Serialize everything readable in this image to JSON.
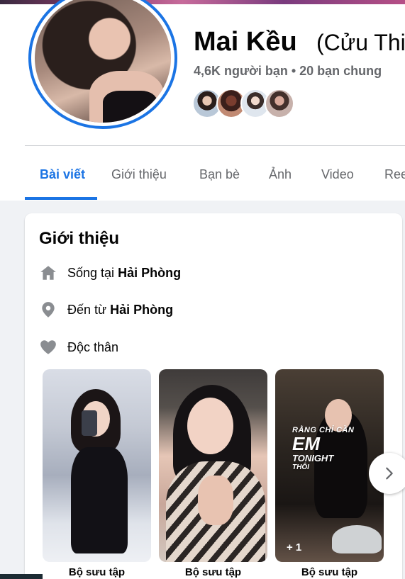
{
  "profile": {
    "name": "Mai Kều",
    "alias": "(Cửu Thi",
    "stats": "4,6K người bạn • 20 bạn chung",
    "mutual_friend_avatars": [
      "friend-avatar",
      "friend-avatar",
      "friend-avatar",
      "friend-avatar"
    ]
  },
  "tabs": [
    {
      "label": "Bài viết",
      "active": true
    },
    {
      "label": "Giới thiệu"
    },
    {
      "label": "Bạn bè"
    },
    {
      "label": "Ảnh"
    },
    {
      "label": "Video"
    },
    {
      "label": "Ree"
    }
  ],
  "intro": {
    "title": "Giới thiệu",
    "lives_in_prefix": "Sống tại",
    "lives_in_place": "Hải Phòng",
    "from_prefix": "Đến từ",
    "from_place": "Hải Phòng",
    "relationship": "Độc thân"
  },
  "featured": {
    "items": [
      {
        "caption": "Bộ sưu tập"
      },
      {
        "caption": "Bộ sưu tập"
      },
      {
        "caption": "Bộ sưu tập",
        "more": "+ 1",
        "overlay": {
          "line1": "RẰNG CHỈ CẦN",
          "line2": "EM",
          "line3": "TONIGHT",
          "line4": "THÔI"
        }
      }
    ]
  },
  "colors": {
    "accent": "#1b74e4",
    "secondary_text": "#65676b",
    "page_bg": "#f0f2f5"
  },
  "icons": {
    "home": "home-icon",
    "pin": "location-pin-icon",
    "heart": "heart-icon",
    "next": "chevron-right-icon"
  }
}
